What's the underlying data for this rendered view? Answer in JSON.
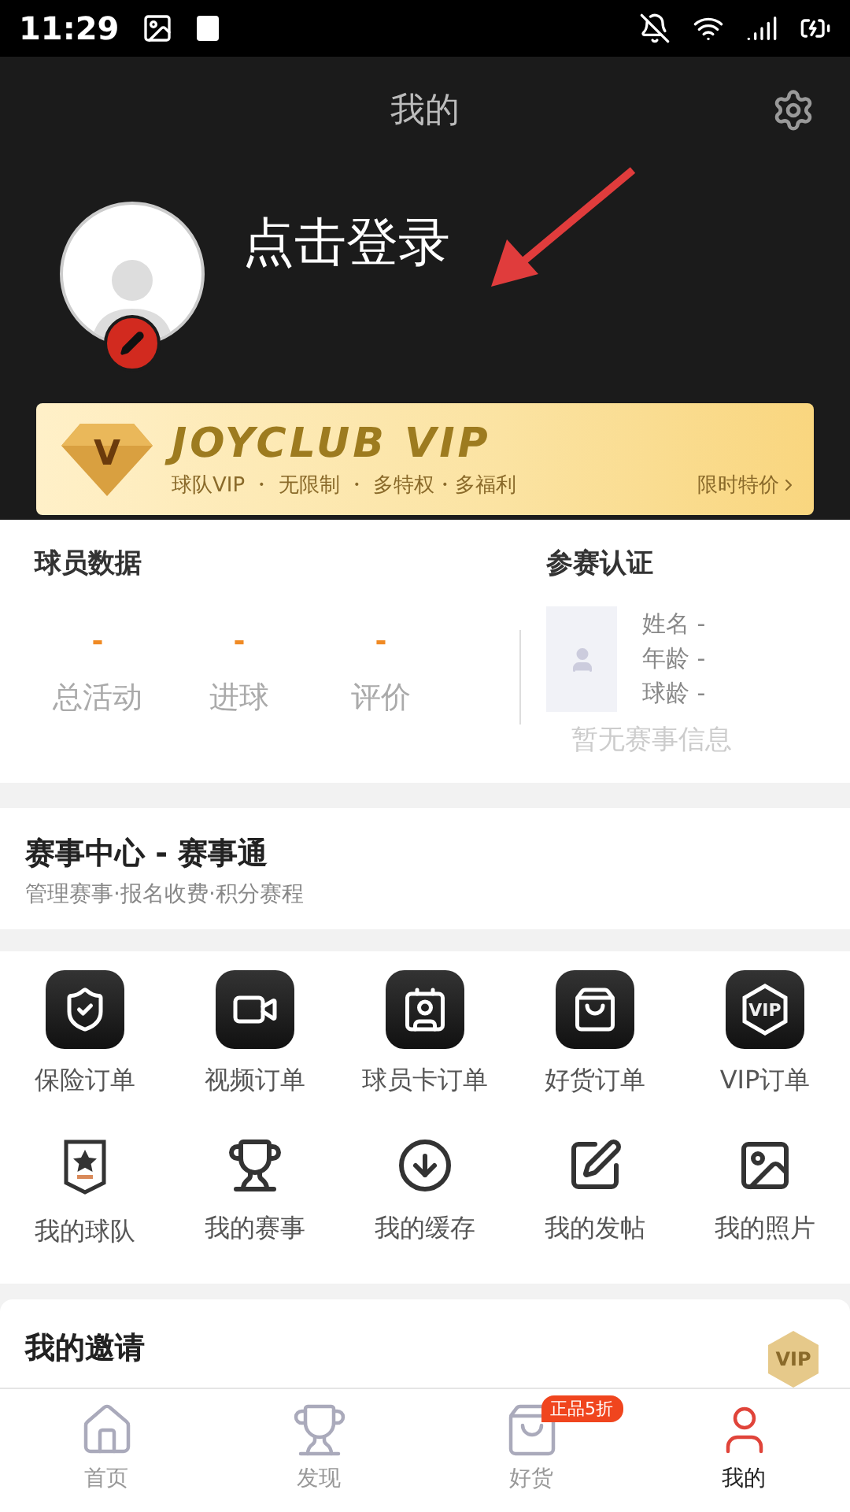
{
  "status_bar": {
    "time": "11:29"
  },
  "header": {
    "title": "我的",
    "login": "点击登录"
  },
  "vip_banner": {
    "logo_letter": "V",
    "title": "JOYCLUB VIP",
    "perks": "球队VIP ・ 无限制 ・ 多特权・多福利",
    "offer": "限时特价"
  },
  "player_stats": {
    "heading": "球员数据",
    "stats": [
      {
        "value": "-",
        "label": "总活动"
      },
      {
        "value": "-",
        "label": "进球"
      },
      {
        "value": "-",
        "label": "评价"
      }
    ]
  },
  "certification": {
    "heading": "参赛认证",
    "fields": [
      "姓名 -",
      "年龄 -",
      "球龄 -"
    ],
    "empty": "暂无赛事信息"
  },
  "event_center": {
    "title": "赛事中心 - 赛事通",
    "subtitle": "管理赛事·报名收费·积分赛程"
  },
  "orders": [
    {
      "label": "保险订单"
    },
    {
      "label": "视频订单"
    },
    {
      "label": "球员卡订单"
    },
    {
      "label": "好货订单"
    },
    {
      "label": "VIP订单",
      "icon_text": "VIP"
    }
  ],
  "shortcuts": [
    {
      "label": "我的球队"
    },
    {
      "label": "我的赛事"
    },
    {
      "label": "我的缓存"
    },
    {
      "label": "我的发帖"
    },
    {
      "label": "我的照片"
    }
  ],
  "invitation": {
    "title": "我的邀请",
    "badge": "VIP"
  },
  "tab_bar": [
    {
      "label": "首页",
      "selected": false
    },
    {
      "label": "发现",
      "selected": false
    },
    {
      "label": "好货",
      "selected": false,
      "badge": "正品5折"
    },
    {
      "label": "我的",
      "selected": true
    }
  ]
}
